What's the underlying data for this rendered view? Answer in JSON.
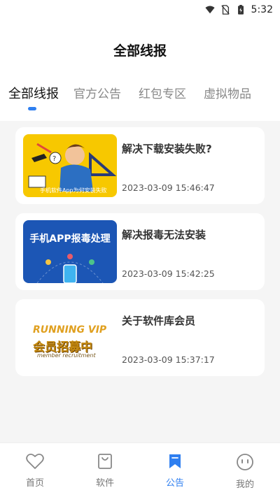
{
  "status_bar": {
    "time": "5:32"
  },
  "page_title": "全部线报",
  "tabs": [
    {
      "label": "全部线报",
      "active": true
    },
    {
      "label": "官方公告",
      "active": false
    },
    {
      "label": "红包专区",
      "active": false
    },
    {
      "label": "虚拟物品",
      "active": false
    }
  ],
  "posts": [
    {
      "title": "解决下载安装失败?",
      "time": "2023-03-09 15:46:47",
      "thumb_caption": "手机软件App为何安装失败"
    },
    {
      "title": "解决报毒无法安装",
      "time": "2023-03-09 15:42:25",
      "thumb_caption": "手机APP报毒处理"
    },
    {
      "title": "关于软件库会员",
      "time": "2023-03-09 15:37:17",
      "thumb_caption_1": "RUNNING VIP",
      "thumb_caption_2": "会员招募中",
      "thumb_caption_3": "member recruitment"
    }
  ],
  "tabbar": {
    "items": [
      {
        "label": "首页",
        "icon": "heart-icon",
        "active": false
      },
      {
        "label": "软件",
        "icon": "bag-icon",
        "active": false
      },
      {
        "label": "公告",
        "icon": "bookmark-icon",
        "active": true
      },
      {
        "label": "我的",
        "icon": "smile-icon",
        "active": false
      }
    ]
  },
  "colors": {
    "accent": "#2f7ff0",
    "background": "#f5f5f5"
  }
}
